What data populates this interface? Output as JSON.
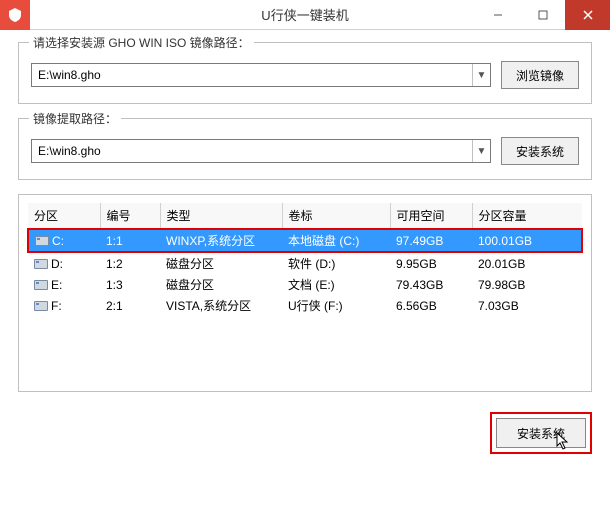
{
  "window": {
    "title": "U行侠一键装机"
  },
  "source": {
    "legend": "请选择安装源 GHO WIN ISO 镜像路径：",
    "value": "E:\\win8.gho",
    "browse": "浏览镜像"
  },
  "dest": {
    "legend": "镜像提取路径：",
    "value": "E:\\win8.gho",
    "install": "安装系统"
  },
  "table": {
    "headers": [
      "分区",
      "编号",
      "类型",
      "卷标",
      "可用空间",
      "分区容量"
    ],
    "rows": [
      {
        "sel": true,
        "drive": "C:",
        "id": "1:1",
        "type": "WINXP,系统分区",
        "label": "本地磁盘 (C:)",
        "free": "97.49GB",
        "total": "100.01GB"
      },
      {
        "sel": false,
        "drive": "D:",
        "id": "1:2",
        "type": "磁盘分区",
        "label": "软件 (D:)",
        "free": "9.95GB",
        "total": "20.01GB"
      },
      {
        "sel": false,
        "drive": "E:",
        "id": "1:3",
        "type": "磁盘分区",
        "label": "文档 (E:)",
        "free": "79.43GB",
        "total": "79.98GB"
      },
      {
        "sel": false,
        "drive": "F:",
        "id": "2:1",
        "type": "VISTA,系统分区",
        "label": "U行侠 (F:)",
        "free": "6.56GB",
        "total": "7.03GB"
      }
    ]
  },
  "footer": {
    "install": "安装系统"
  }
}
